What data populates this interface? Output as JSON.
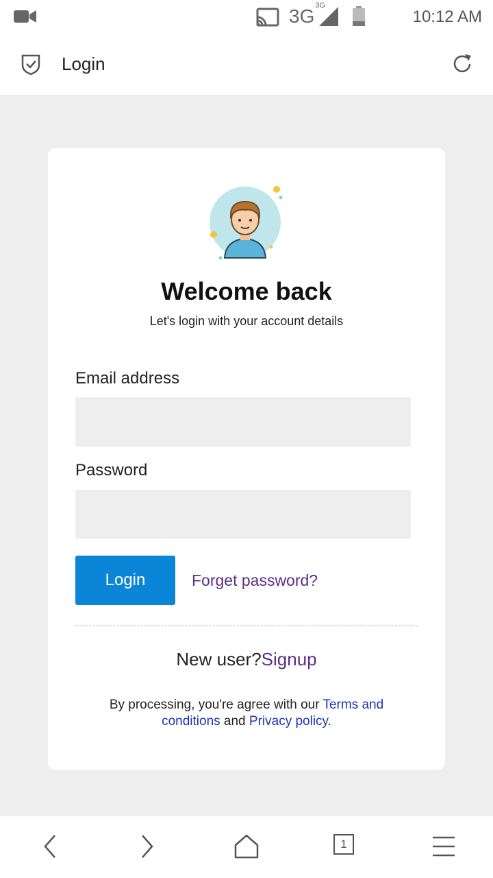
{
  "status_bar": {
    "time": "10:12 AM",
    "network": "3G",
    "network_sup": "3G",
    "icons": [
      "video-camera-icon",
      "cast-icon",
      "signal-icon",
      "battery-icon"
    ]
  },
  "app_bar": {
    "title": "Login",
    "icons": [
      "shield-check-icon",
      "reload-icon"
    ]
  },
  "card": {
    "heading": "Welcome back",
    "subtitle": "Let's login with your account details",
    "email_label": "Email address",
    "email_value": "",
    "password_label": "Password",
    "password_value": "",
    "login_button": "Login",
    "forgot_link": "Forget password?",
    "new_user_text": "New user?",
    "signup_link": "Signup",
    "terms_prefix": "By processing, you're agree with our ",
    "terms_link": "Terms and conditions",
    "terms_and": " and ",
    "privacy_link": "Privacy policy",
    "terms_suffix": "."
  },
  "bottom_nav": {
    "tab_count": "1",
    "icons": [
      "back-icon",
      "forward-icon",
      "home-icon",
      "tabs-icon",
      "menu-icon"
    ]
  },
  "colors": {
    "primary_button": "#0a85d8",
    "link_purple": "#5b2e87",
    "link_blue": "#1a35b8",
    "page_background": "#eeeeee"
  }
}
